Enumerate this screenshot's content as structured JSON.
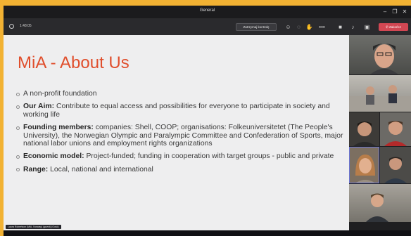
{
  "window": {
    "title": "General",
    "controls": {
      "minimize": "–",
      "maximize": "❐",
      "close": "✕"
    }
  },
  "toolbar": {
    "timer": "1:48:05",
    "control_button": "Zatrzymaj kontrolę",
    "leave_button": "✆ Zakończ",
    "icons": [
      "participants-icon",
      "chat-icon",
      "reactions-icon",
      "more-icon",
      "camera-icon",
      "mic-icon",
      "share-icon"
    ]
  },
  "slide": {
    "title": "MiA - About Us",
    "bullets": [
      {
        "label": "",
        "text": "A non-profit foundation"
      },
      {
        "label": "Our Aim:",
        "text": " Contribute to equal access and possibilities for everyone to participate in society and working life"
      },
      {
        "label": "Founding members:",
        "text": " companies: Shell, COOP; organisations: Folkeuniversitetet (The People's University), the Norwegian Olympic and Paralympic Committee and Confederation of Sports, major national labor unions and employment rights organizations"
      },
      {
        "label": "Economic model:",
        "text": " Project-funded; funding in cooperation with target groups - public and private"
      },
      {
        "label": "Range:",
        "text": " Local, national and international"
      }
    ],
    "presenter_tag": "Laura Robertson (MiA, Norway) (guest) (Gość)"
  },
  "colors": {
    "title_accent": "#e04e2c",
    "leave_button": "#d24753",
    "frame": "#f2b233"
  }
}
